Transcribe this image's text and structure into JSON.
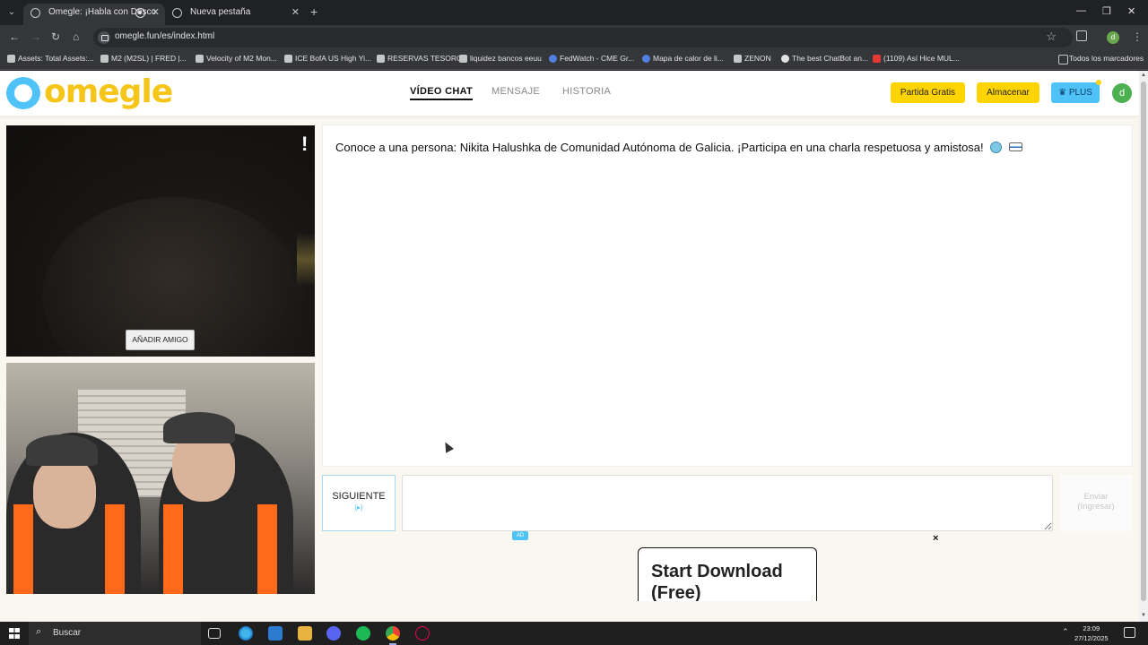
{
  "browser": {
    "tabs": [
      {
        "title": "Omegle: ¡Habla con Desco",
        "active": true
      },
      {
        "title": "Nueva pestaña",
        "active": false
      }
    ],
    "url": "omegle.fun/es/index.html",
    "bookmarks": [
      "Assets: Total Assets:...",
      "M2 (M2SL) | FRED |...",
      "Velocity of M2 Mon...",
      "ICE BofA US High Yi...",
      "RESERVAS TESORO",
      "liquidez bancos eeuu",
      "FedWatch - CME Gr...",
      "Mapa de calor de li...",
      "ZENON",
      "The best ChatBot an...",
      "(1109) Así Hice MUL..."
    ],
    "all_bookmarks": "Todos los marcadores",
    "profile_initial": "d"
  },
  "site": {
    "logo_text": "omegle",
    "nav": [
      "VÍDEO CHAT",
      "MENSAJE",
      "HISTORIA"
    ],
    "free_match": "Partida Gratis",
    "store": "Almacenar",
    "plus": "PLUS",
    "avatar_initial": "d"
  },
  "video": {
    "report": "!",
    "add_friend": "AÑADIR AMIGO"
  },
  "chat": {
    "message": "Conoce a una persona: Nikita Halushka de Comunidad Autónoma de Galicia. ¡Participa en una charla respetuosa y amistosa!",
    "next_label": "SIGUIENTE",
    "next_key": "(▸)",
    "send_label": "Enviar",
    "send_hint": "(Ingresar)"
  },
  "ad": {
    "badge": "AD",
    "close": "×",
    "headline": "Start Download (Free)"
  },
  "taskbar": {
    "search": "Buscar",
    "time": "23:09",
    "date": "27/12/2025"
  }
}
